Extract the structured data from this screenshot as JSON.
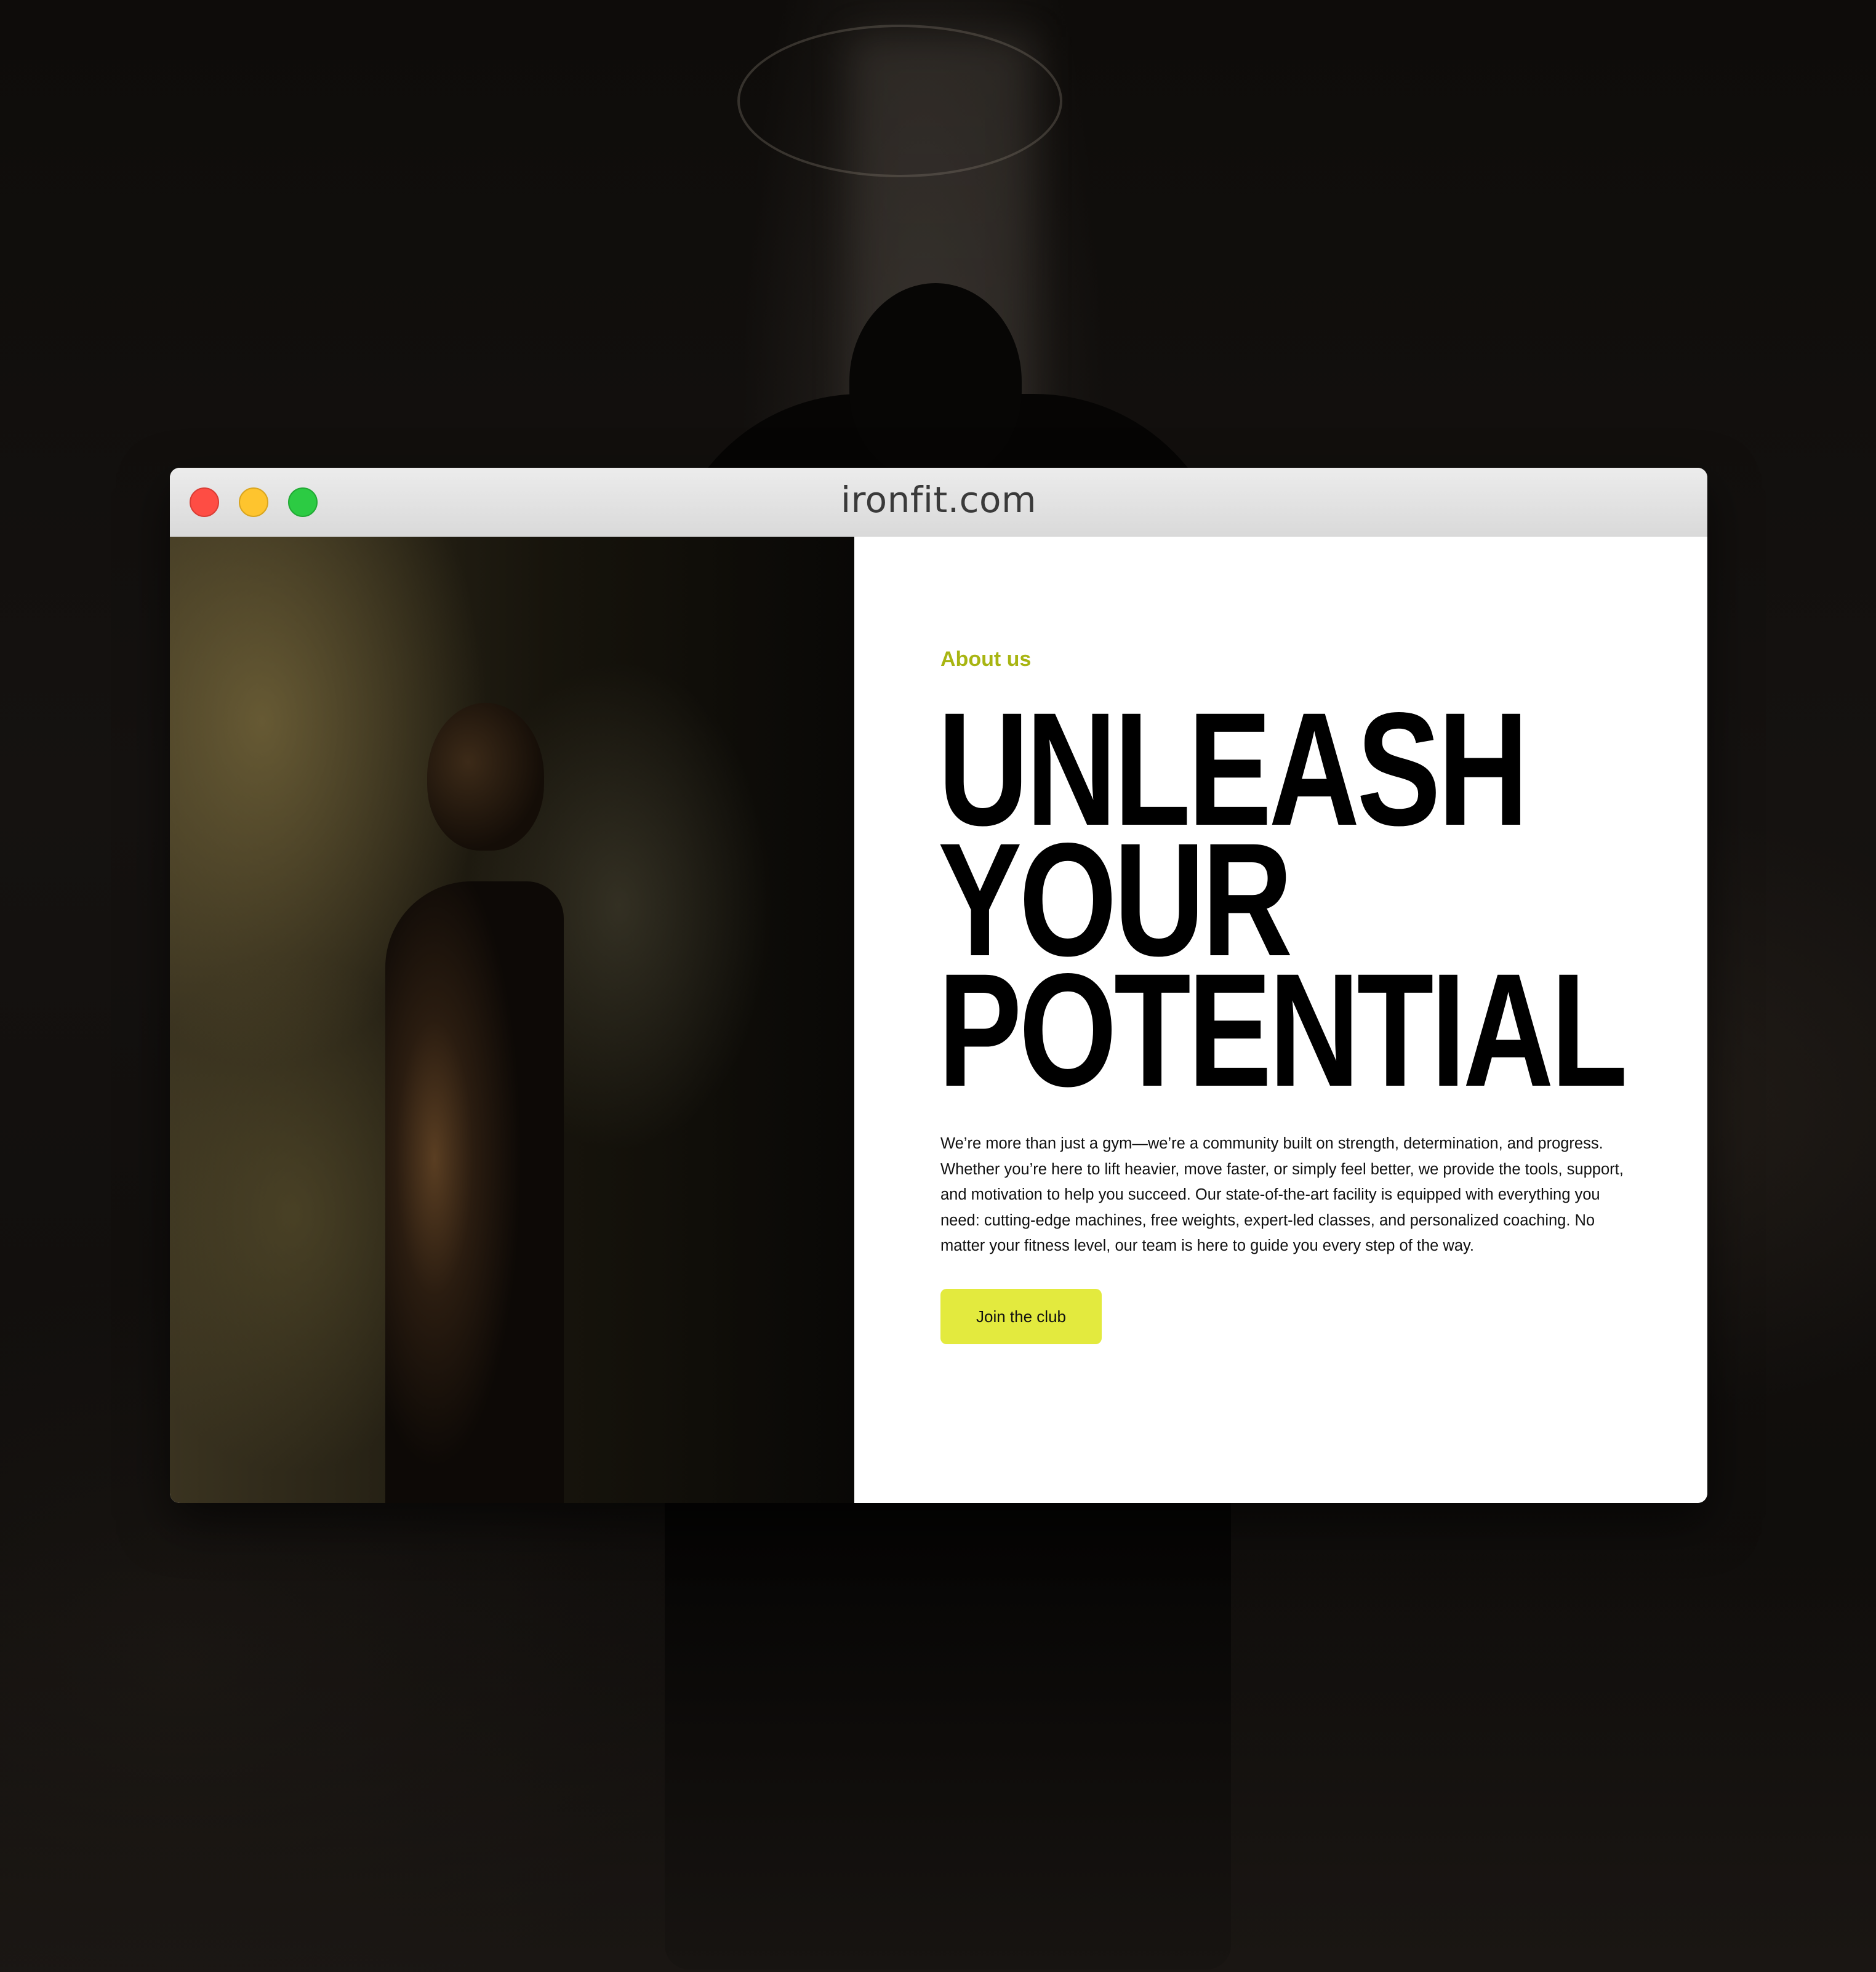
{
  "browser": {
    "url": "ironfit.com"
  },
  "about": {
    "eyebrow": "About us",
    "headline_lines": [
      "UNLEASH",
      "YOUR",
      "POTENTIAL"
    ],
    "body": "We’re more than just a gym—we’re a community built on strength, determination, and progress. Whether you’re here to lift heavier, move faster, or simply feel better, we provide the tools, support, and motivation to help you succeed. Our state-of-the-art facility is equipped with everything you need: cutting-edge machines, free weights, expert-led classes, and personalized coaching. No matter your fitness level, our team is here to guide you every step of the way.",
    "cta_label": "Join the club"
  },
  "colors": {
    "accent": "#e3ea3e",
    "eyebrow": "#a8b512",
    "close": "#fe4d44",
    "minimize": "#fec42e",
    "maximize": "#2ccb43"
  }
}
